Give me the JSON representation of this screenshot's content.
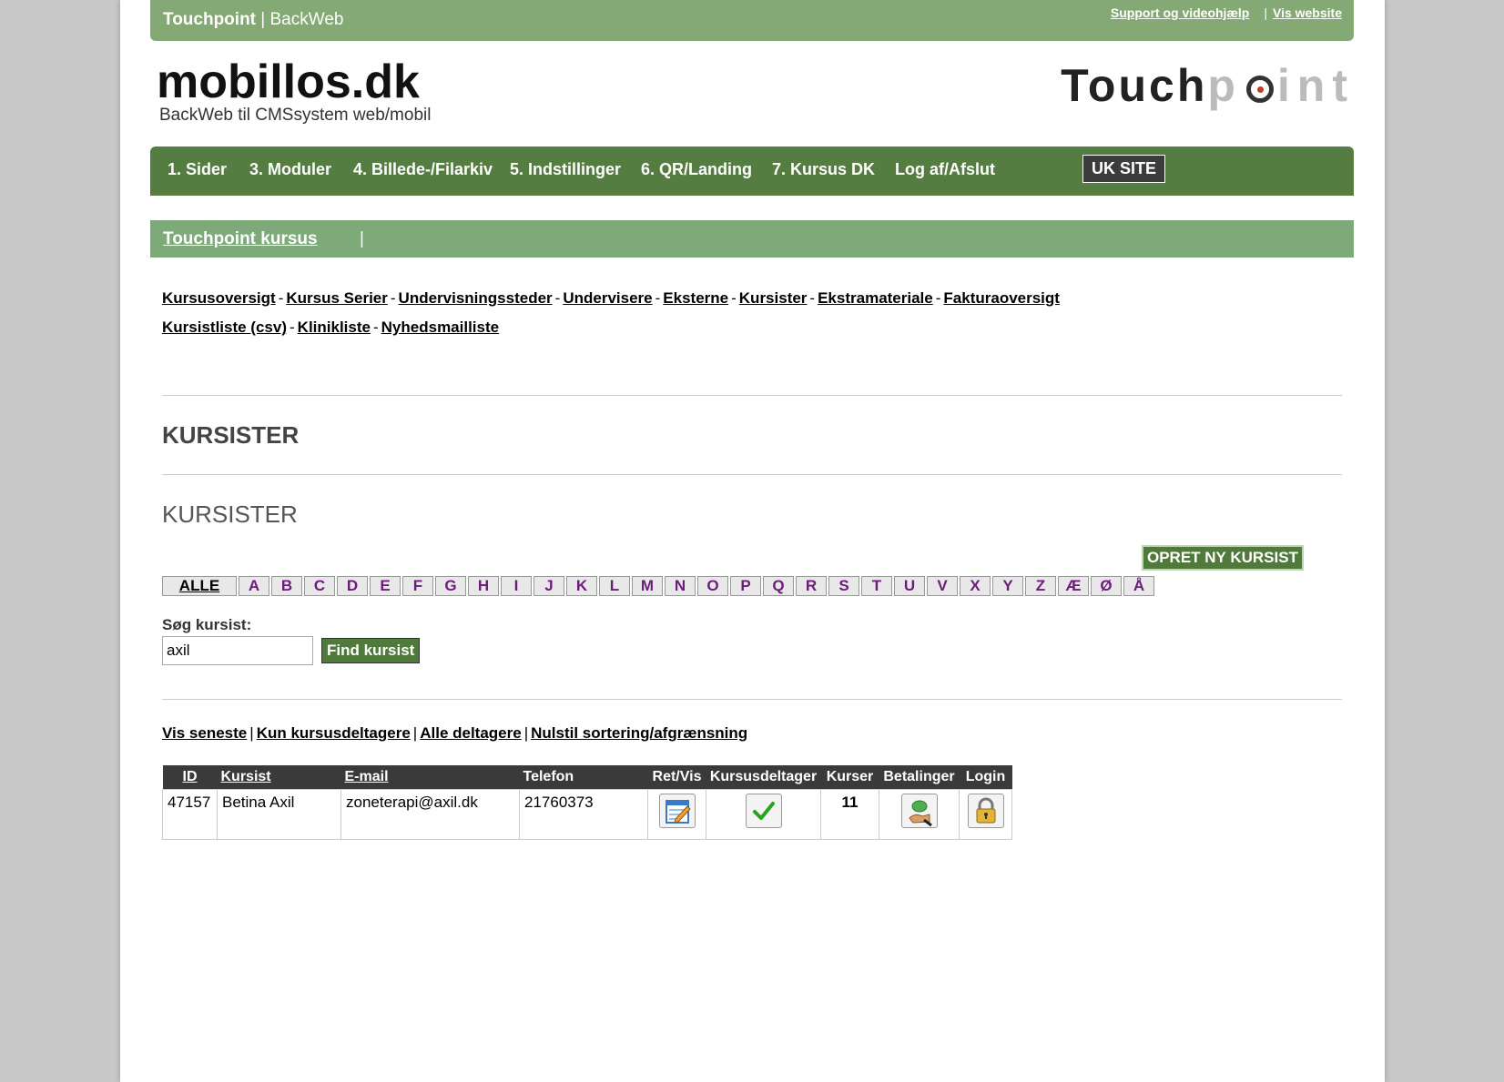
{
  "topbar": {
    "brand_bold": "Touchpoint",
    "brand_rest": " | BackWeb",
    "support_link": "Support og videohjælp",
    "separator": "|",
    "website_link": "Vis website"
  },
  "logo": {
    "main": "mobillos.dk",
    "sub": "BackWeb til CMSsystem web/mobil"
  },
  "tp_logo": {
    "dark": "Touch",
    "p": "p",
    "light": "int"
  },
  "mainnav": {
    "items": [
      "1. Sider",
      "3. Moduler",
      "4. Billede-/Filarkiv",
      "5. Indstillinger",
      "6. QR/Landing",
      "7. Kursus DK",
      "Log af/Afslut"
    ],
    "uk_site": "UK SITE"
  },
  "subhead": {
    "link": "Touchpoint kursus",
    "pipe": "|"
  },
  "sublinks": {
    "row1": [
      "Kursusoversigt",
      "Kursus Serier",
      "Undervisningssteder",
      "Undervisere",
      "Eksterne",
      "Kursister",
      "Ekstramateriale",
      "Fakturaoversigt"
    ],
    "row2": [
      "Kursistliste (csv)",
      "Klinikliste",
      "Nyhedsmailliste"
    ],
    "separator": "-"
  },
  "headings": {
    "h1": "KURSISTER",
    "h2": "KURSISTER"
  },
  "create_button": "OPRET NY KURSIST",
  "alphabet": [
    "ALLE",
    "A",
    "B",
    "C",
    "D",
    "E",
    "F",
    "G",
    "H",
    "I",
    "J",
    "K",
    "L",
    "M",
    "N",
    "O",
    "P",
    "Q",
    "R",
    "S",
    "T",
    "U",
    "V",
    "X",
    "Y",
    "Z",
    "Æ",
    "Ø",
    "Å"
  ],
  "search": {
    "label": "Søg kursist:",
    "value": "axil",
    "button": "Find kursist"
  },
  "filters": [
    "Vis seneste",
    "Kun kursusdeltagere",
    "Alle deltagere",
    "Nulstil sortering/afgrænsning"
  ],
  "filter_separator": "|",
  "table": {
    "headers": {
      "id": "ID",
      "kursist": "Kursist",
      "email": "E-mail",
      "telefon": "Telefon",
      "retvis": "Ret/Vis",
      "deltager": "Kursusdeltager",
      "kurser": "Kurser",
      "betalinger": "Betalinger",
      "login": "Login"
    },
    "rows": [
      {
        "id": "47157",
        "kursist": "Betina Axil",
        "email": "zoneterapi@axil.dk",
        "telefon": "21760373",
        "kurser": "11",
        "icons": {
          "retvis": "edit-icon",
          "deltager": "checkmark-icon",
          "betalinger": "payment-icon",
          "login": "lock-icon"
        }
      }
    ]
  },
  "colors": {
    "topbar": "#84a974",
    "mainnav": "#557c41",
    "subhead": "#7daa78",
    "button": "#4f7a3b",
    "alpha_letter": "#6e1b7c"
  }
}
